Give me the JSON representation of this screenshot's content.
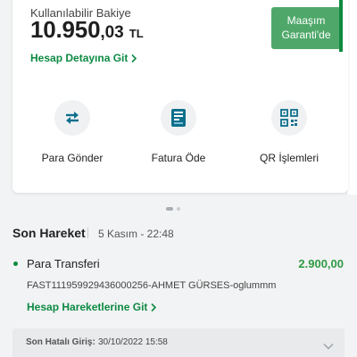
{
  "balance": {
    "label": "Kullanılabilir Bakiye",
    "integer": "10.950",
    "decimal": ",03",
    "currency": "TL",
    "badge_line1": "Maaşım",
    "badge_line2": "Garanti'de",
    "detail_link": "Hesap Detayına Git"
  },
  "actions": [
    {
      "label": "Para Gönder",
      "icon": "transfer-arrows-icon"
    },
    {
      "label": "Fatura Öde",
      "icon": "bill-document-icon"
    },
    {
      "label": "QR İşlemleri",
      "icon": "qr-code-icon"
    }
  ],
  "carousel": {
    "active_index": 0,
    "count": 2
  },
  "recent": {
    "title": "Son Hareket",
    "date": "5 Kasım - 22:48",
    "transaction": {
      "title": "Para Transferi",
      "amount": "2.900,00",
      "description": "FAST111959929436000256-AHMET GÜRSES-oglummm"
    },
    "history_link": "Hesap Hareketlerine Git"
  },
  "last_failed_login": {
    "label": "Son Hatalı Giriş:",
    "value": "30/10/2022 15:58"
  },
  "colors": {
    "accent": "#0e8a3e",
    "badge": "#4fa86a",
    "amount": "#2f9a44"
  }
}
